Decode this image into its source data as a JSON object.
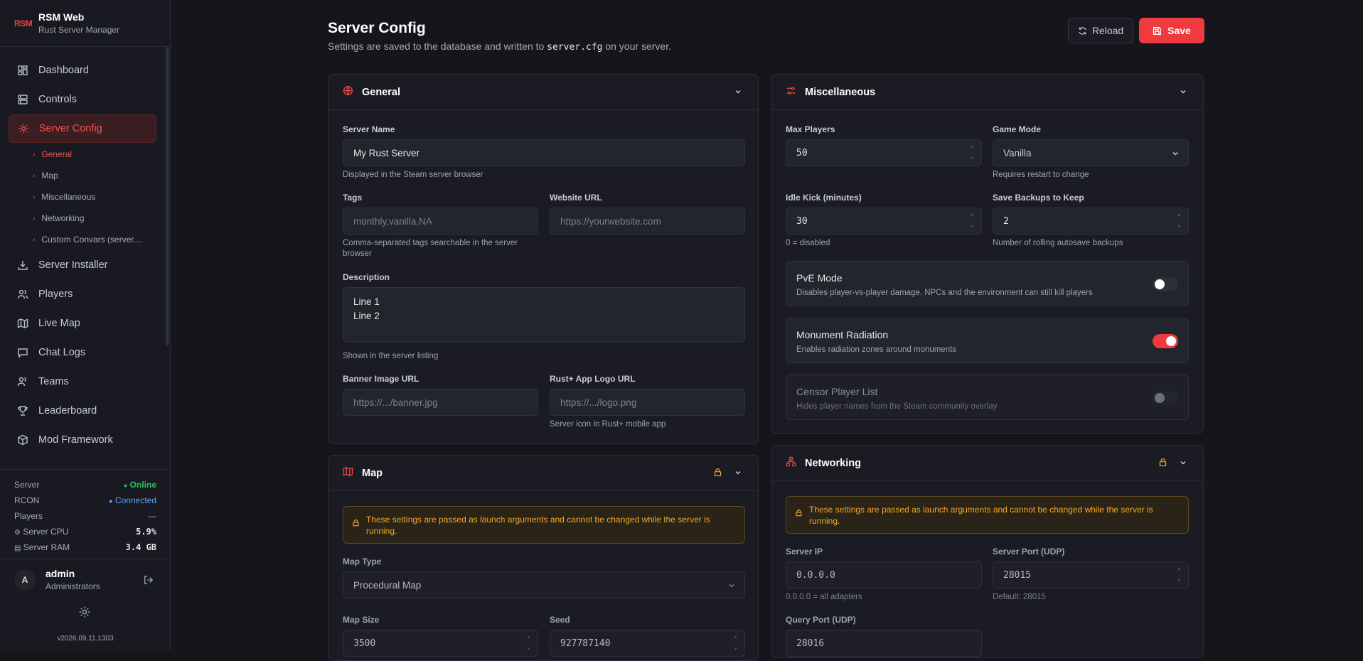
{
  "brand": {
    "logo": "RSM",
    "title": "RSM Web",
    "subtitle": "Rust Server Manager"
  },
  "nav": {
    "dashboard": "Dashboard",
    "controls": "Controls",
    "server_config": "Server Config",
    "sub": [
      "General",
      "Map",
      "Miscellaneous",
      "Networking",
      "Custom Convars (server...."
    ],
    "server_installer": "Server Installer",
    "players": "Players",
    "live_map": "Live Map",
    "chat_logs": "Chat Logs",
    "teams": "Teams",
    "leaderboard": "Leaderboard",
    "mod_framework": "Mod Framework"
  },
  "status": {
    "server_label": "Server",
    "server_value": "Online",
    "rcon_label": "RCON",
    "rcon_value": "Connected",
    "players_label": "Players",
    "players_value": "—",
    "cpu_label": "Server CPU",
    "cpu_value": "5.9%",
    "ram_label": "Server RAM",
    "ram_value": "3.4 GB",
    "online_color": "#22c55e",
    "connected_color": "#3b82f6"
  },
  "user": {
    "initial": "A",
    "name": "admin",
    "role": "Administrators"
  },
  "version": "v2026.09.11.1303",
  "header": {
    "title": "Server Config",
    "subtitle_pre": "Settings are saved to the database and written to",
    "subtitle_code": "server.cfg",
    "subtitle_post": "on your server.",
    "reload": "Reload",
    "save": "Save"
  },
  "general": {
    "title": "General",
    "server_name_label": "Server Name",
    "server_name_value": "My Rust Server",
    "server_name_hint": "Displayed in the Steam server browser",
    "tags_label": "Tags",
    "tags_placeholder": "monthly,vanilla,NA",
    "tags_hint_1": "Comma-separated tags searchable in the server",
    "tags_hint_2": "browser",
    "website_label": "Website URL",
    "website_placeholder": "https://yourwebsite.com",
    "description_label": "Description",
    "description_line1": "Line 1",
    "description_line2": "Line 2",
    "description_hint": "Shown in the server listing",
    "banner_label": "Banner Image URL",
    "banner_placeholder": "https://.../banner.jpg",
    "logo_label": "Rust+ App Logo URL",
    "logo_placeholder": "https://.../logo.png",
    "logo_hint": "Server icon in Rust+ mobile app"
  },
  "misc": {
    "title": "Miscellaneous",
    "max_players_label": "Max Players",
    "max_players_value": "50",
    "game_mode_label": "Game Mode",
    "game_mode_value": "Vanilla",
    "game_mode_hint": "Requires restart to change",
    "idle_label": "Idle Kick (minutes)",
    "idle_value": "30",
    "idle_hint": "0 = disabled",
    "backups_label": "Save Backups to Keep",
    "backups_value": "2",
    "backups_hint": "Number of rolling autosave backups",
    "pve_title": "PvE Mode",
    "pve_desc": "Disables player-vs-player damage. NPCs and the environment can still kill players",
    "pve_on": false,
    "rad_title": "Monument Radiation",
    "rad_desc": "Enables radiation zones around monuments",
    "rad_on": true,
    "censor_title": "Censor Player List",
    "censor_desc": "Hides player names from the Steam community overlay",
    "censor_on": false
  },
  "map": {
    "title": "Map",
    "warning": "These settings are passed as launch arguments and cannot be changed while the server is running.",
    "map_type_label": "Map Type",
    "map_type_value": "Procedural Map",
    "map_size_label": "Map Size",
    "map_size_value": "3500",
    "seed_label": "Seed",
    "seed_value": "927787140"
  },
  "networking": {
    "title": "Networking",
    "warning": "These settings are passed as launch arguments and cannot be changed while the server is running.",
    "ip_label": "Server IP",
    "ip_value": "0.0.0.0",
    "ip_hint": "0.0.0.0 = all adapters",
    "port_label": "Server Port (UDP)",
    "port_value": "28015",
    "port_hint": "Default: 28015",
    "query_label": "Query Port (UDP)",
    "query_value": "28016"
  },
  "colors": {
    "accent": "#ef3b40",
    "warning": "#f5a623",
    "bg": "#15161c"
  }
}
